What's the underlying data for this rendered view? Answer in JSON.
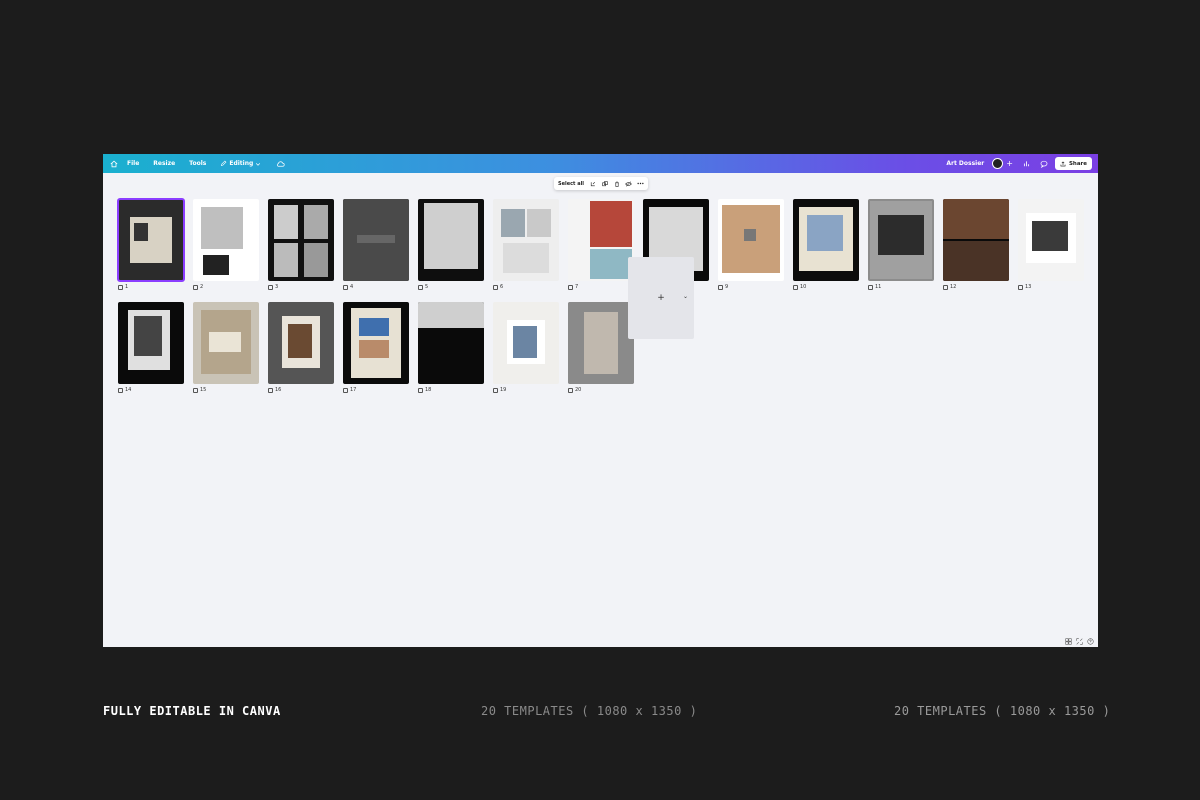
{
  "topbar": {
    "menu": [
      "File",
      "Resize",
      "Tools"
    ],
    "editing_label": "Editing",
    "doc_title": "Art Dossier",
    "share_label": "Share"
  },
  "float_toolbar": {
    "select_all": "Select all"
  },
  "pages": [
    {
      "num": "1",
      "bg": "#2b2b2b",
      "selected": true
    },
    {
      "num": "2",
      "bg": "#ffffff"
    },
    {
      "num": "3",
      "bg": "#111111"
    },
    {
      "num": "4",
      "bg": "#3a3a3a"
    },
    {
      "num": "5",
      "bg": "#0e0e0e"
    },
    {
      "num": "6",
      "bg": "#eeeeee"
    },
    {
      "num": "7",
      "bg": "#f4f4f4"
    },
    {
      "num": "8",
      "bg": "#0a0a0a"
    },
    {
      "num": "9",
      "bg": "#ffffff"
    },
    {
      "num": "10",
      "bg": "#0c0c0c"
    },
    {
      "num": "11",
      "bg": "#8c8c8c"
    },
    {
      "num": "12",
      "bg": "#0a0a0a"
    },
    {
      "num": "13",
      "bg": "#f3f3f3"
    },
    {
      "num": "14",
      "bg": "#0a0a0a"
    },
    {
      "num": "15",
      "bg": "#c9c3b6"
    },
    {
      "num": "16",
      "bg": "#555555"
    },
    {
      "num": "17",
      "bg": "#0b0b0b"
    },
    {
      "num": "18",
      "bg": "#0a0a0a"
    },
    {
      "num": "19",
      "bg": "#f0efec"
    },
    {
      "num": "20",
      "bg": "#9d9d9d"
    }
  ],
  "add_page": {
    "plus": "+",
    "chevron": "⌄"
  },
  "captions": {
    "left": "FULLY EDITABLE IN CANVA",
    "middle": "20 TEMPLATES ( 1080 x 1350 )",
    "right": "20 TEMPLATES ( 1080 x 1350 )"
  },
  "colors": {
    "accent": "#8b3dff",
    "background": "#1c1c1c",
    "canvas": "#f2f3f7"
  }
}
